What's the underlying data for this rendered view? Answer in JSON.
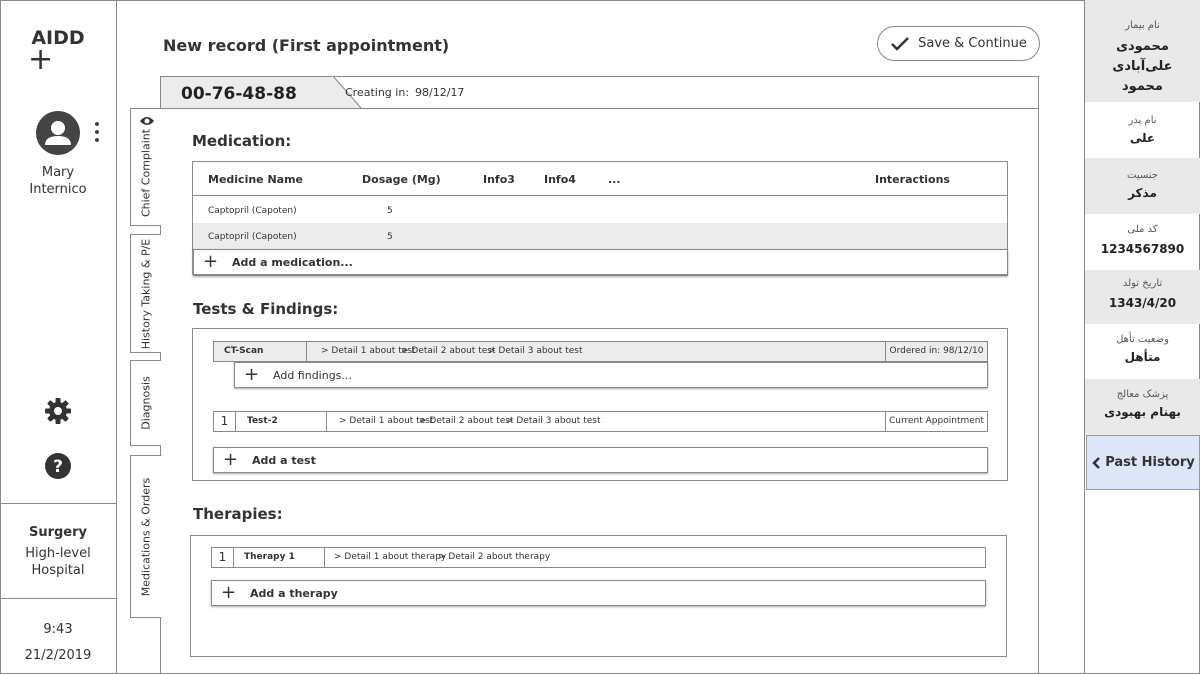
{
  "app": {
    "logo": "AIDD",
    "logo_mark": "+"
  },
  "user": {
    "name_line1": "Mary",
    "name_line2": "Internico"
  },
  "location": {
    "department": "Surgery",
    "hospital_line1": "High-level",
    "hospital_line2": "Hospital"
  },
  "clock": {
    "time": "9:43",
    "date": "21/2/2019"
  },
  "header": {
    "title": "New record (First appointment)",
    "save_label": "Save & Continue"
  },
  "record": {
    "id": "00-76-48-88",
    "creating_label": "Creating in:",
    "creating_date": "98/12/17"
  },
  "tabs": [
    "Chief Complaint",
    "History Taking & P/E",
    "Diagnosis",
    "Medications & Orders"
  ],
  "medication": {
    "title": "Medication:",
    "columns": [
      "Medicine Name",
      "Dosage (Mg)",
      "Info3",
      "Info4",
      "...",
      "Interactions"
    ],
    "rows": [
      {
        "name": "Captopril (Capoten)",
        "dosage": "5"
      },
      {
        "name": "Captopril (Capoten)",
        "dosage": "5"
      }
    ],
    "add_label": "Add a medication..."
  },
  "tests": {
    "title": "Tests & Findings:",
    "items": [
      {
        "index": "",
        "name": "CT-Scan",
        "details": [
          "> Detail 1 about test",
          "> Detail 2 about test",
          "> Detail 3 about test"
        ],
        "status": "Ordered in: 98/12/10",
        "add_findings": "Add findings..."
      },
      {
        "index": "1",
        "name": "Test-2",
        "details": [
          "> Detail 1 about test",
          "> Detail 2 about test",
          "> Detail 3 about test"
        ],
        "status": "Current Appointment"
      }
    ],
    "add_label": "Add a test"
  },
  "therapies": {
    "title": "Therapies:",
    "items": [
      {
        "index": "1",
        "name": "Therapy 1",
        "details": [
          "> Detail 1 about therapy",
          "> Detail 2 about therapy"
        ]
      }
    ],
    "add_label": "Add a therapy"
  },
  "patient": {
    "name_label": "نام بیمار",
    "name_line1": "محمودی علی‌آبادی",
    "name_line2": "محمود",
    "father_label": "نام پدر",
    "father": "علی",
    "gender_label": "جنسیت",
    "gender": "مذکر",
    "national_id_label": "کد ملی",
    "national_id": "1234567890",
    "birth_label": "تاریخ تولد",
    "birth": "1343/4/20",
    "marital_label": "وضعیت تأهل",
    "marital": "متأهل",
    "doctor_label": "پزشک معالج",
    "doctor": "بهنام بهبودی",
    "past_history_label": "Past History"
  },
  "colors": {
    "border": "#888888",
    "gray_fill": "#ececec",
    "past_history_bg": "#dde6f6"
  },
  "icons": [
    "user-icon",
    "kebab-icon",
    "gear-icon",
    "help-icon",
    "check-icon",
    "eye-icon",
    "plus-icon",
    "chevron-left-icon"
  ]
}
